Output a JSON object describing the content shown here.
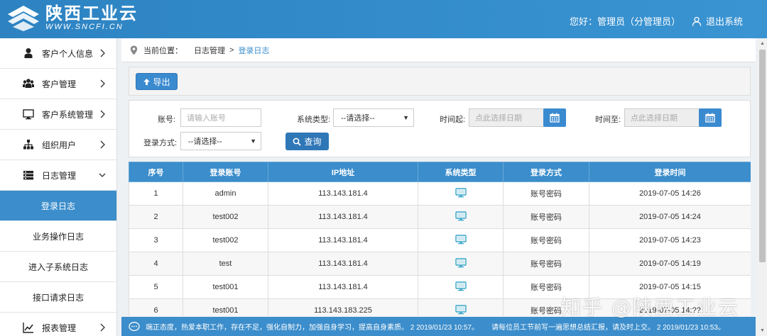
{
  "header": {
    "logo_text": "陕西工业云",
    "logo_url": "WWW.SNCFI.CN",
    "greeting": "您好：管理员（分管理员）",
    "logout_label": "退出系统"
  },
  "sidebar": {
    "items": [
      {
        "label": "客户个人信息",
        "icon": "user-icon"
      },
      {
        "label": "客户管理",
        "icon": "users-icon"
      },
      {
        "label": "客户系统管理",
        "icon": "monitor-icon"
      },
      {
        "label": "组织用户",
        "icon": "org-icon"
      },
      {
        "label": "日志管理",
        "icon": "log-icon"
      }
    ],
    "sub_items": [
      {
        "label": "登录日志",
        "active": true
      },
      {
        "label": "业务操作日志",
        "active": false
      },
      {
        "label": "进入子系统日志",
        "active": false
      },
      {
        "label": "接口请求日志",
        "active": false
      }
    ],
    "report": {
      "label": "报表管理",
      "icon": "chart-icon"
    }
  },
  "breadcrumb": {
    "prefix": "当前位置：",
    "parent": "日志管理",
    "separator": ">",
    "current": "登录日志"
  },
  "toolbar": {
    "export_label": "导出"
  },
  "filters": {
    "account_label": "账号:",
    "account_placeholder": "请输入账号",
    "system_type_label": "系统类型:",
    "system_type_value": "--请选择--",
    "time_from_label": "时间起:",
    "time_from_placeholder": "点此选择日期",
    "time_to_label": "时间至:",
    "time_to_placeholder": "点此选择日期",
    "login_method_label": "登录方式:",
    "login_method_value": "--请选择--",
    "query_label": "查询"
  },
  "table": {
    "headers": [
      "序号",
      "登录账号",
      "IP地址",
      "系统类型",
      "登录方式",
      "登录时间"
    ],
    "rows": [
      {
        "no": "1",
        "account": "admin",
        "ip": "113.143.181.4",
        "system_icon": "monitor-icon",
        "method": "账号密码",
        "time": "2019-07-05 14:26"
      },
      {
        "no": "2",
        "account": "test002",
        "ip": "113.143.181.4",
        "system_icon": "monitor-icon",
        "method": "账号密码",
        "time": "2019-07-05 14:24"
      },
      {
        "no": "3",
        "account": "test002",
        "ip": "113.143.181.4",
        "system_icon": "monitor-icon",
        "method": "账号密码",
        "time": "2019-07-05 14:23"
      },
      {
        "no": "4",
        "account": "test",
        "ip": "113.143.181.4",
        "system_icon": "monitor-icon",
        "method": "账号密码",
        "time": "2019-07-05 14:19"
      },
      {
        "no": "5",
        "account": "test001",
        "ip": "113.143.181.4",
        "system_icon": "monitor-icon",
        "method": "账号密码",
        "time": "2019-07-05 14:15"
      },
      {
        "no": "6",
        "account": "test001",
        "ip": "113.143.183.225",
        "system_icon": "monitor-icon",
        "method": "账号密码",
        "time": "2019-07-05 14:??"
      }
    ]
  },
  "notice": {
    "message_1": "端正态度，热爱本职工作，存在不足，强化自制力，加强自身学习，提高自身素质。 2 2019/01/23 10:57。",
    "message_2": "请每位员工节前写一遍思想总结汇报，请及时上交。 2 2019/01/23 10:53。"
  },
  "watermark": "知乎 @陕西工业云",
  "colors": {
    "primary": "#3b8dcb",
    "header": "#2d83c2",
    "button": "#3a8ad0",
    "icon_teal": "#3aa7c9"
  }
}
